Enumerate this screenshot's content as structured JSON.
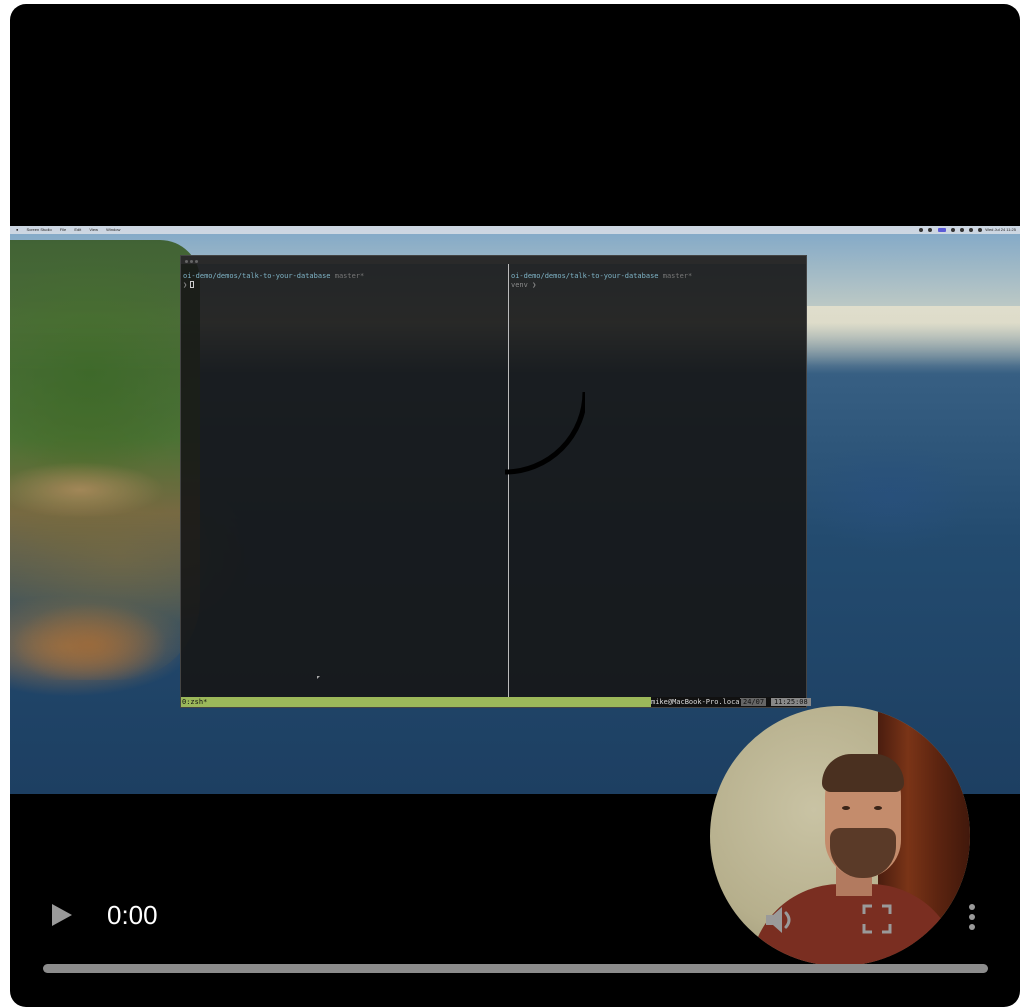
{
  "player": {
    "current_time": "0:00",
    "progress": 0,
    "state": "paused"
  },
  "icons": {
    "play": "play-icon",
    "volume": "volume-icon",
    "fullscreen": "fullscreen-icon",
    "more": "more-vertical-icon",
    "loading": "loading-spinner-icon"
  },
  "terminal": {
    "left_pane": {
      "path": "oi-demo/demos/talk-to-your-database",
      "branch": "master*",
      "prompt": "❯"
    },
    "right_pane": {
      "path": "oi-demo/demos/talk-to-your-database",
      "branch": "master*",
      "prompt": "venv ❯"
    },
    "status": {
      "window": "0:zsh*",
      "host": "mike@MacBook-Pro.local",
      "date": "24/07",
      "time": "11:25:08"
    }
  },
  "menubar": {
    "items": [
      "Screen Studio",
      "File",
      "Edit",
      "View",
      "Window"
    ],
    "clock": "Wed Jul 24 11:25"
  },
  "colors": {
    "progress_track": "#8c8c8c",
    "control_icons": "#9a9a9a",
    "status_bar": "#9cb85a"
  }
}
